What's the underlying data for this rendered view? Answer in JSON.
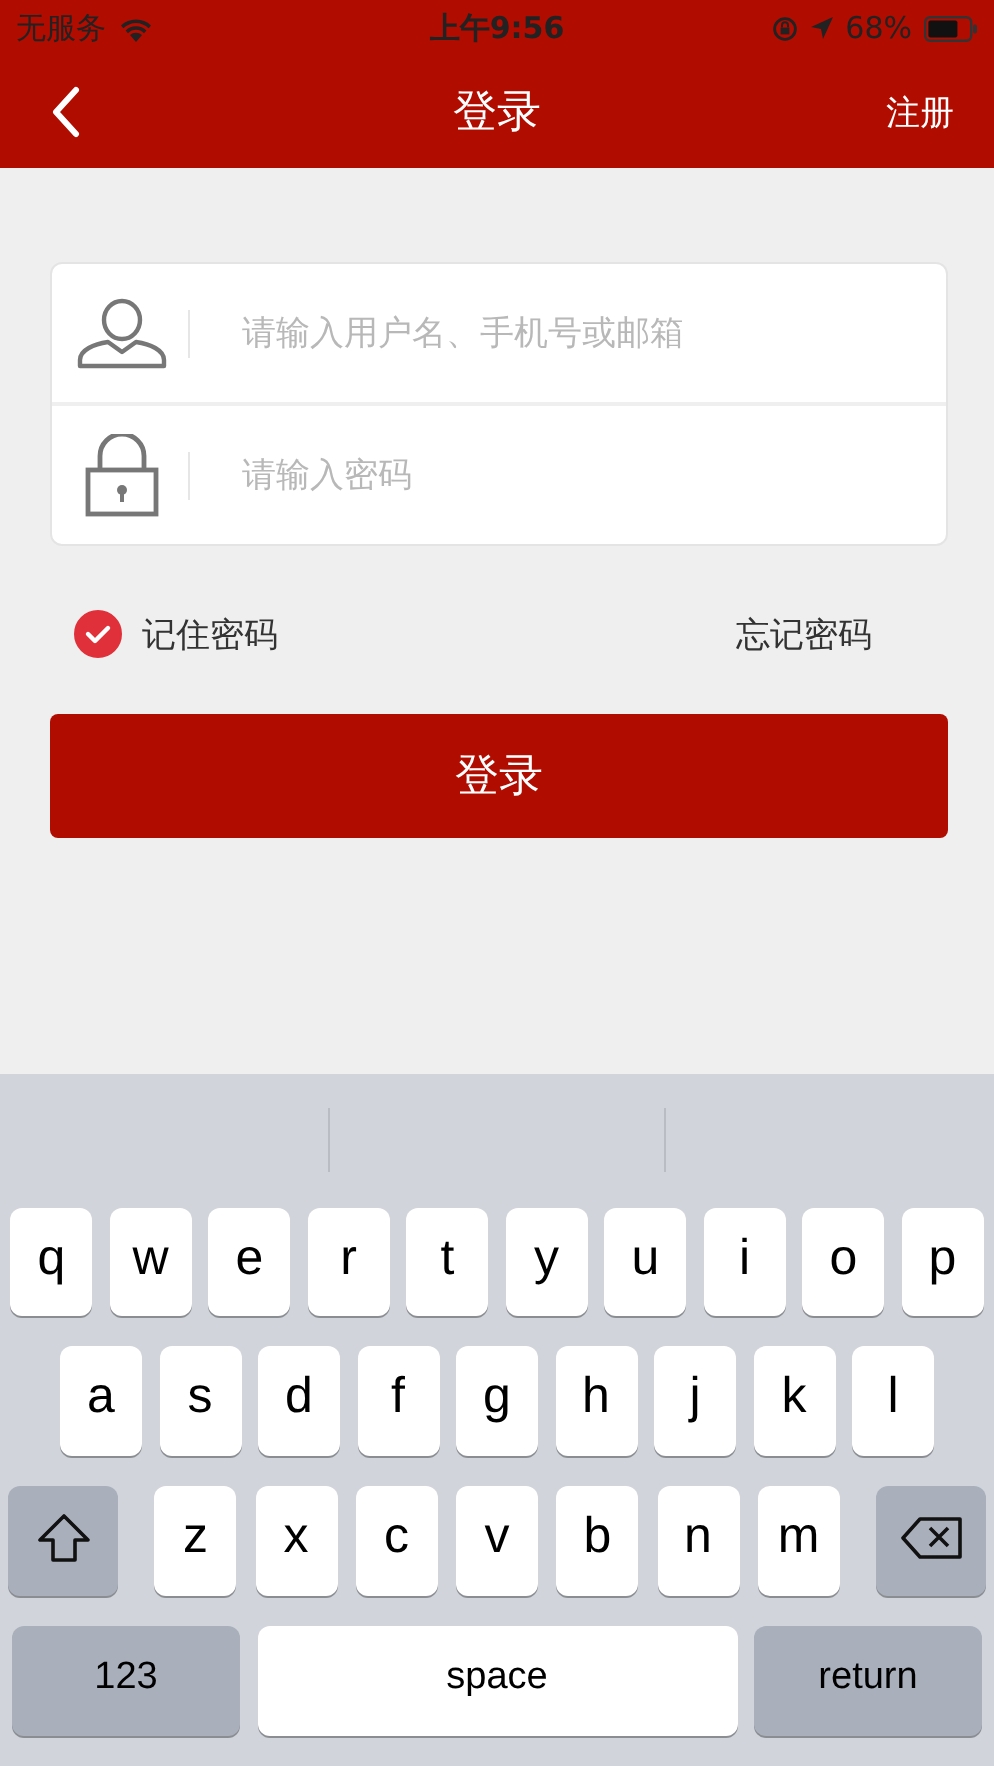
{
  "status_bar": {
    "carrier": "无服务",
    "time": "上午9:56",
    "battery": "68%"
  },
  "nav": {
    "title": "登录",
    "action": "注册"
  },
  "form": {
    "fields": [
      {
        "kind": "user",
        "placeholder": "请输入用户名、手机号或邮箱"
      },
      {
        "kind": "password",
        "placeholder": "请输入密码"
      }
    ],
    "remember": {
      "label": "记住密码",
      "checked": true
    },
    "forgot": "忘记密码",
    "submit": "登录"
  },
  "keyboard": {
    "rows": [
      {
        "keys": [
          {
            "kind": "letter",
            "label": "q"
          },
          {
            "kind": "letter",
            "label": "w"
          },
          {
            "kind": "letter",
            "label": "e"
          },
          {
            "kind": "letter",
            "label": "r"
          },
          {
            "kind": "letter",
            "label": "t"
          },
          {
            "kind": "letter",
            "label": "y"
          },
          {
            "kind": "letter",
            "label": "u"
          },
          {
            "kind": "letter",
            "label": "i"
          },
          {
            "kind": "letter",
            "label": "o"
          },
          {
            "kind": "letter",
            "label": "p"
          }
        ]
      },
      {
        "keys": [
          {
            "kind": "letter",
            "label": "a"
          },
          {
            "kind": "letter",
            "label": "s"
          },
          {
            "kind": "letter",
            "label": "d"
          },
          {
            "kind": "letter",
            "label": "f"
          },
          {
            "kind": "letter",
            "label": "g"
          },
          {
            "kind": "letter",
            "label": "h"
          },
          {
            "kind": "letter",
            "label": "j"
          },
          {
            "kind": "letter",
            "label": "k"
          },
          {
            "kind": "letter",
            "label": "l"
          }
        ]
      },
      {
        "keys": [
          {
            "kind": "shift"
          },
          {
            "kind": "letter",
            "label": "z"
          },
          {
            "kind": "letter",
            "label": "x"
          },
          {
            "kind": "letter",
            "label": "c"
          },
          {
            "kind": "letter",
            "label": "v"
          },
          {
            "kind": "letter",
            "label": "b"
          },
          {
            "kind": "letter",
            "label": "n"
          },
          {
            "kind": "letter",
            "label": "m"
          },
          {
            "kind": "delete"
          }
        ]
      }
    ],
    "bottom_row": {
      "mode_key": "123",
      "space_key": "space",
      "return_key": "return"
    }
  }
}
